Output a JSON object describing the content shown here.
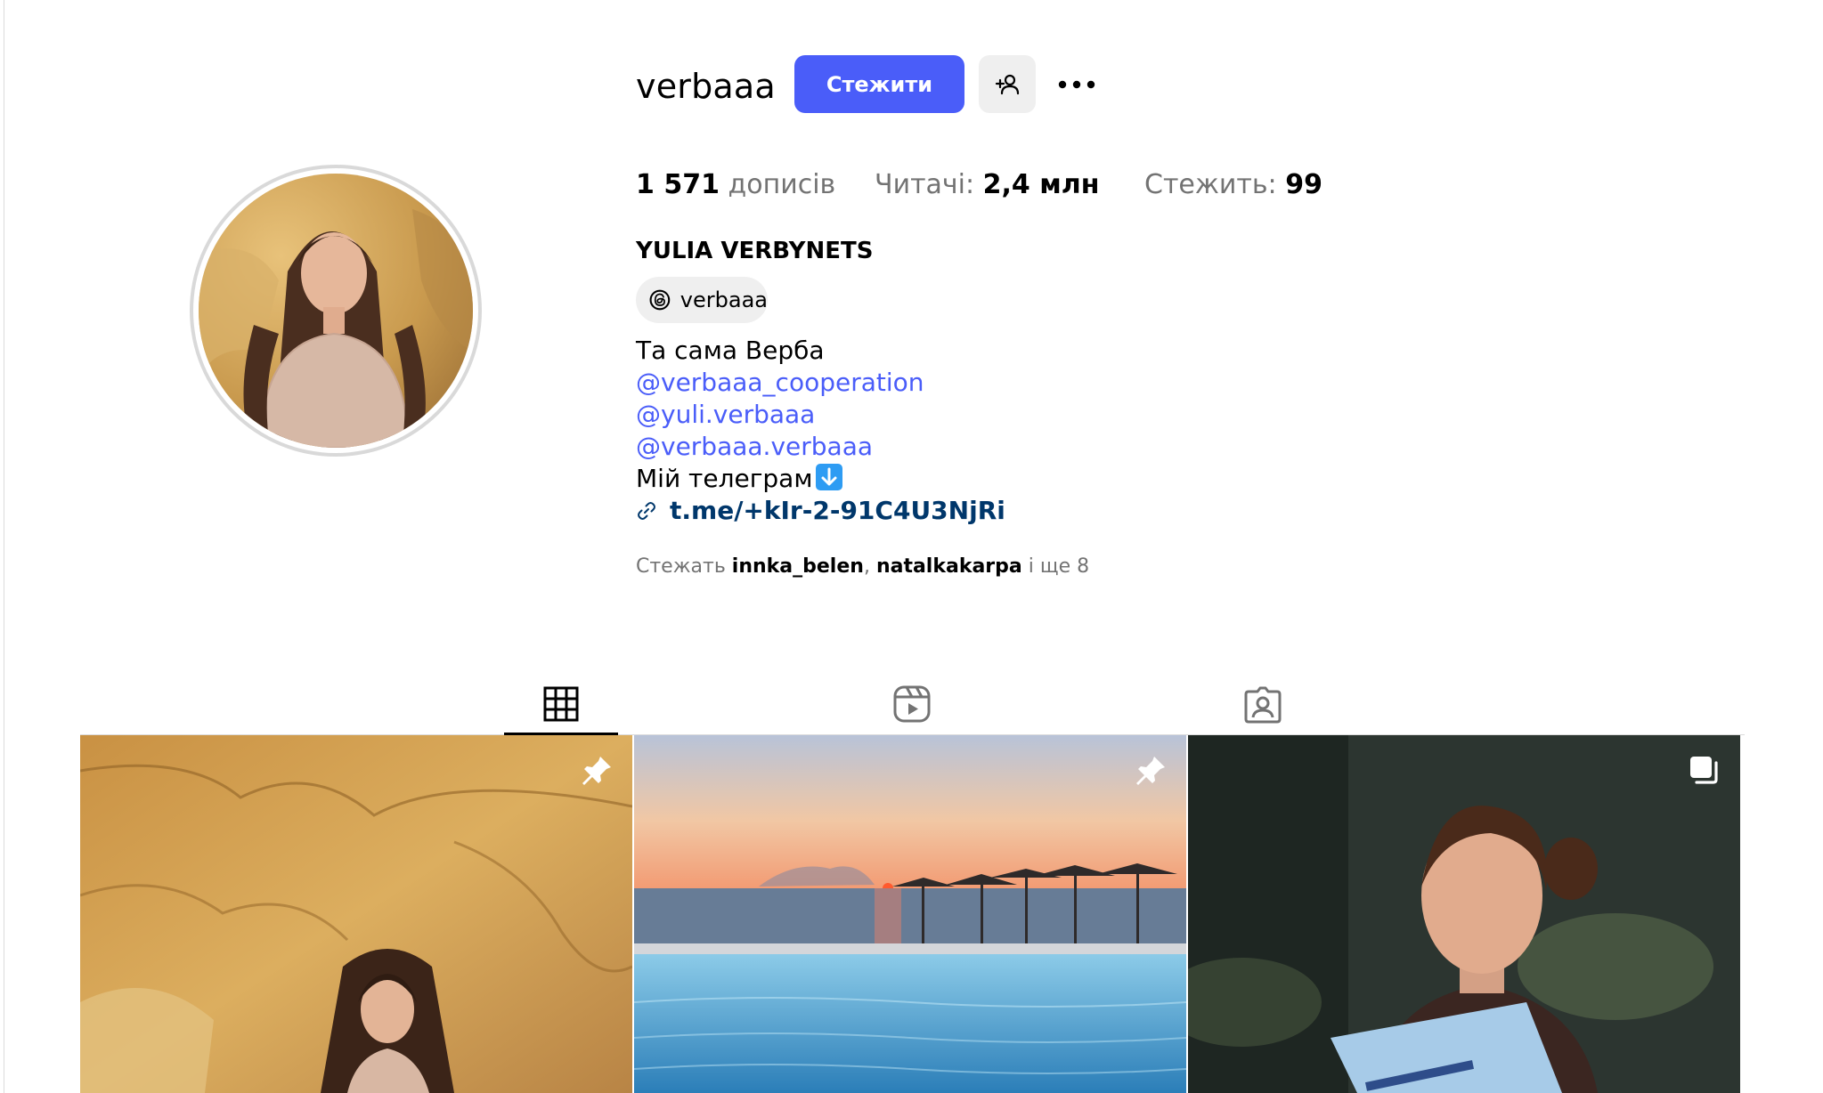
{
  "profile": {
    "username": "verbaaa",
    "follow_label": "Стежити",
    "full_name": "YULIA VERBYNETS",
    "threads_handle": "verbaaa"
  },
  "stats": {
    "posts_count": "1 571",
    "posts_label": "дописів",
    "followers_label": "Читачі:",
    "followers_count": "2,4 млн",
    "following_label": "Стежить:",
    "following_count": "99"
  },
  "bio": {
    "line1": "Та сама Верба",
    "mention1": "@verbaaa_cooperation",
    "mention2": "@yuli.verbaaa",
    "mention3": "@verbaaa.verbaaa",
    "line_telegram": "Мій телеграм",
    "link": "t.me/+kIr-2-91C4U3NjRi"
  },
  "followed_by": {
    "prefix": "Стежать",
    "user1": "innka_belen",
    "separator": ",",
    "user2": "natalkakarpa",
    "suffix": "і ще 8"
  },
  "tabs": [
    {
      "icon": "grid-icon",
      "active": true
    },
    {
      "icon": "reels-icon",
      "active": false
    },
    {
      "icon": "tagged-icon",
      "active": false
    }
  ],
  "posts": [
    {
      "badge": "pin-icon"
    },
    {
      "badge": "pin-icon"
    },
    {
      "badge": "carousel-icon"
    }
  ],
  "colors": {
    "accent": "#4a5df9",
    "link": "#00376b",
    "secondary_text": "#737373",
    "button_gray": "#efefef"
  }
}
